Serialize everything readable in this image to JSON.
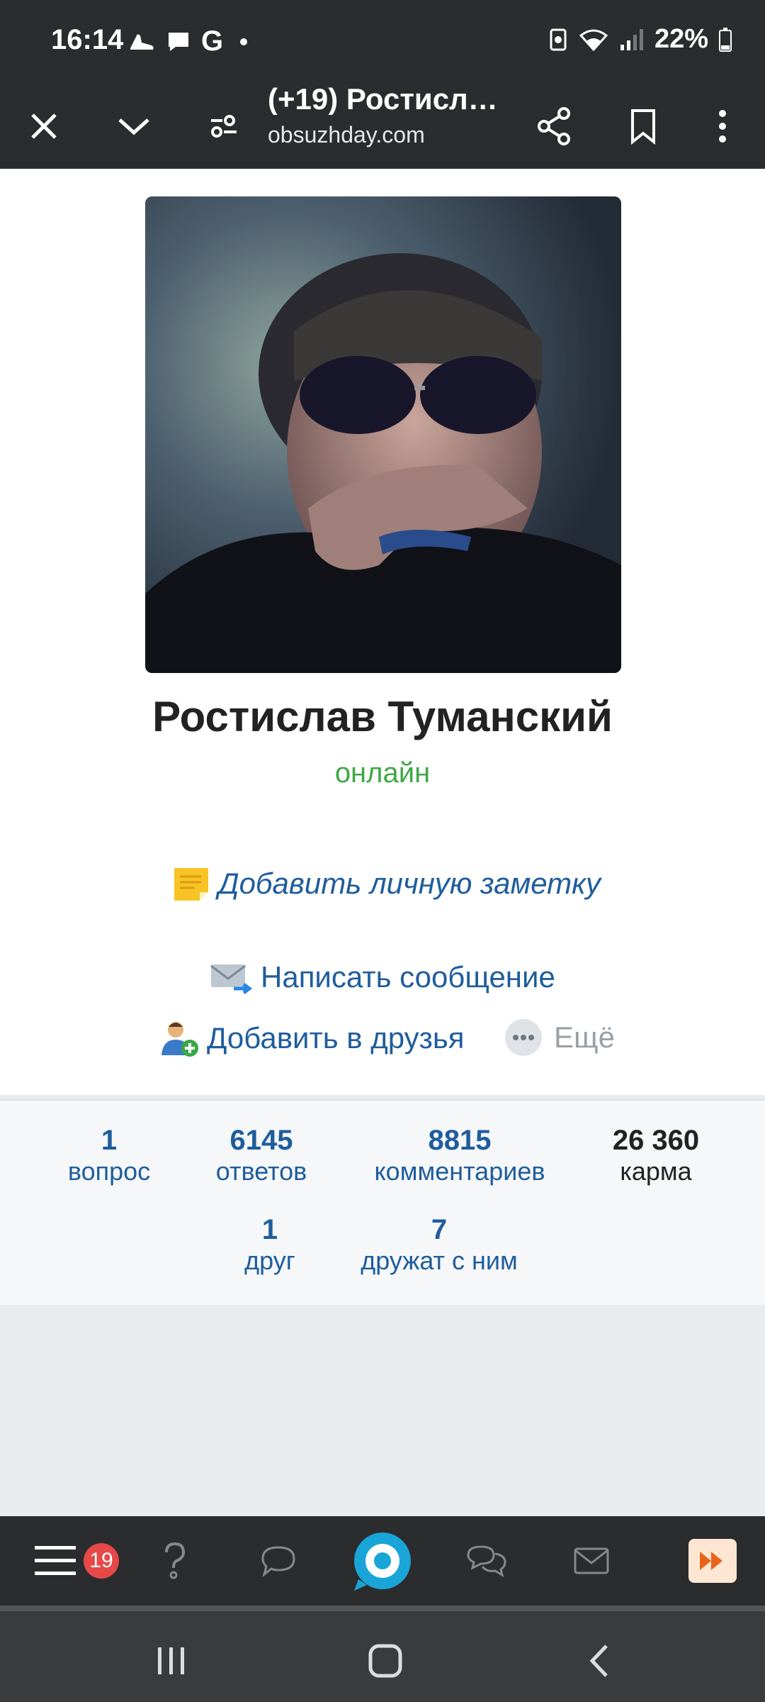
{
  "status_bar": {
    "time": "16:14",
    "notification_letter": "G",
    "battery_percent": "22%"
  },
  "browser": {
    "tab_title": "(+19) Ростислав Туманский",
    "url": "obsuzhday.com"
  },
  "profile": {
    "name": "Ростислав Туманский",
    "status": "онлайн",
    "avatar_alt": "avatar"
  },
  "actions": {
    "add_note": "Добавить личную заметку",
    "write_message": "Написать сообщение",
    "add_friend": "Добавить в друзья",
    "more": "Ещё"
  },
  "stats": [
    {
      "value": "1",
      "label": "вопрос"
    },
    {
      "value": "6145",
      "label": "ответов"
    },
    {
      "value": "8815",
      "label": "комментариев"
    },
    {
      "value": "26 360",
      "label": "карма"
    },
    {
      "value": "1",
      "label": "друг"
    },
    {
      "value": "7",
      "label": "дружат с ним"
    }
  ],
  "bottom_nav": {
    "badge_count": "19",
    "icons": [
      "menu-icon",
      "question-icon",
      "comment-icon",
      "home-logo-icon",
      "chats-icon",
      "mail-icon",
      "fast-forward-icon"
    ]
  },
  "colors": {
    "link": "#1f5d9c",
    "online": "#3fa845",
    "badge": "#e74848",
    "bars": "#2b2c2e"
  }
}
